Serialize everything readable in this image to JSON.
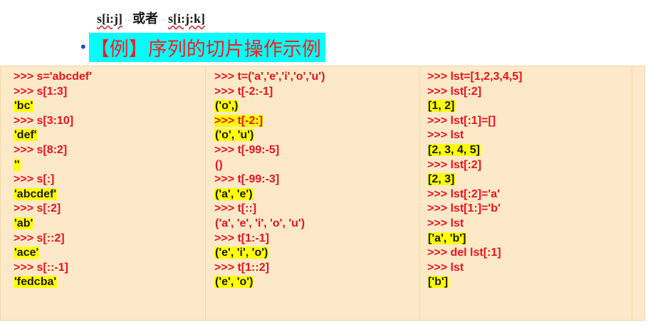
{
  "top": {
    "part1": "s[i:j]",
    "middle": "或者",
    "part2": "s[i:j:k]"
  },
  "heading": {
    "bullet": "•",
    "text": "【例】序列的切片操作示例"
  },
  "columns": [
    [
      {
        "kind": "cmd",
        "text": ">>> s='abcdef'"
      },
      {
        "kind": "cmd",
        "text": ">>> s[1:3]"
      },
      {
        "kind": "out",
        "text": "'bc'"
      },
      {
        "kind": "cmd",
        "text": ">>> s[3:10]"
      },
      {
        "kind": "out",
        "text": "'def'"
      },
      {
        "kind": "cmd",
        "text": ">>> s[8:2]"
      },
      {
        "kind": "out",
        "text": "''"
      },
      {
        "kind": "cmd",
        "text": ">>> s[:]"
      },
      {
        "kind": "out",
        "text": "'abcdef'"
      },
      {
        "kind": "cmd",
        "text": ">>> s[:2]"
      },
      {
        "kind": "out",
        "text": "'ab'"
      },
      {
        "kind": "cmd",
        "text": ">>> s[::2]"
      },
      {
        "kind": "out",
        "text": "'ace'"
      },
      {
        "kind": "cmd",
        "text": ">>> s[::-1]"
      },
      {
        "kind": "out",
        "text": "'fedcba'"
      }
    ],
    [
      {
        "kind": "cmd",
        "text": ">>> t=('a','e','i','o','u')"
      },
      {
        "kind": "cmd",
        "text": ">>> t[-2:-1]"
      },
      {
        "kind": "out",
        "text": "('o',)"
      },
      {
        "kind": "cmd-hl",
        "text": ">>> t[-2:]"
      },
      {
        "kind": "out",
        "text": "('o', 'u')"
      },
      {
        "kind": "cmd",
        "text": ">>> t[-99:-5]"
      },
      {
        "kind": "out-red",
        "text": "()"
      },
      {
        "kind": "cmd",
        "text": ">>> t[-99:-3]"
      },
      {
        "kind": "out",
        "text": "('a', 'e')"
      },
      {
        "kind": "cmd",
        "text": ">>> t[::]"
      },
      {
        "kind": "out-red",
        "text": "('a', 'e', 'i', 'o', 'u')"
      },
      {
        "kind": "cmd",
        "text": ">>> t[1:-1]"
      },
      {
        "kind": "out",
        "text": "('e', 'i', 'o')"
      },
      {
        "kind": "cmd",
        "text": ">>> t[1::2]"
      },
      {
        "kind": "out",
        "text": "('e', 'o')"
      }
    ],
    [
      {
        "kind": "cmd",
        "text": ">>> lst=[1,2,3,4,5]"
      },
      {
        "kind": "cmd",
        "text": ">>> lst[:2]"
      },
      {
        "kind": "out",
        "text": "[1, 2]"
      },
      {
        "kind": "cmd",
        "text": ">>> lst[:1]=[]"
      },
      {
        "kind": "cmd",
        "text": ">>> lst"
      },
      {
        "kind": "out",
        "text": "[2, 3, 4, 5]"
      },
      {
        "kind": "cmd",
        "text": ">>> lst[:2]"
      },
      {
        "kind": "out",
        "text": "[2, 3]"
      },
      {
        "kind": "cmd",
        "text": ">>> lst[:2]='a'"
      },
      {
        "kind": "cmd",
        "text": ">>> lst[1:]='b'"
      },
      {
        "kind": "cmd",
        "text": ">>> lst"
      },
      {
        "kind": "out",
        "text": "['a', 'b']"
      },
      {
        "kind": "cmd",
        "text": ">>> del lst[:1]"
      },
      {
        "kind": "cmd",
        "text": ">>> lst"
      },
      {
        "kind": "out",
        "text": "['b']"
      }
    ]
  ],
  "colors": {
    "panel_bg": "#fde9c8",
    "code_red": "#e8121d",
    "highlight_yellow": "#ffff00",
    "heading_bg": "#00ffff"
  }
}
